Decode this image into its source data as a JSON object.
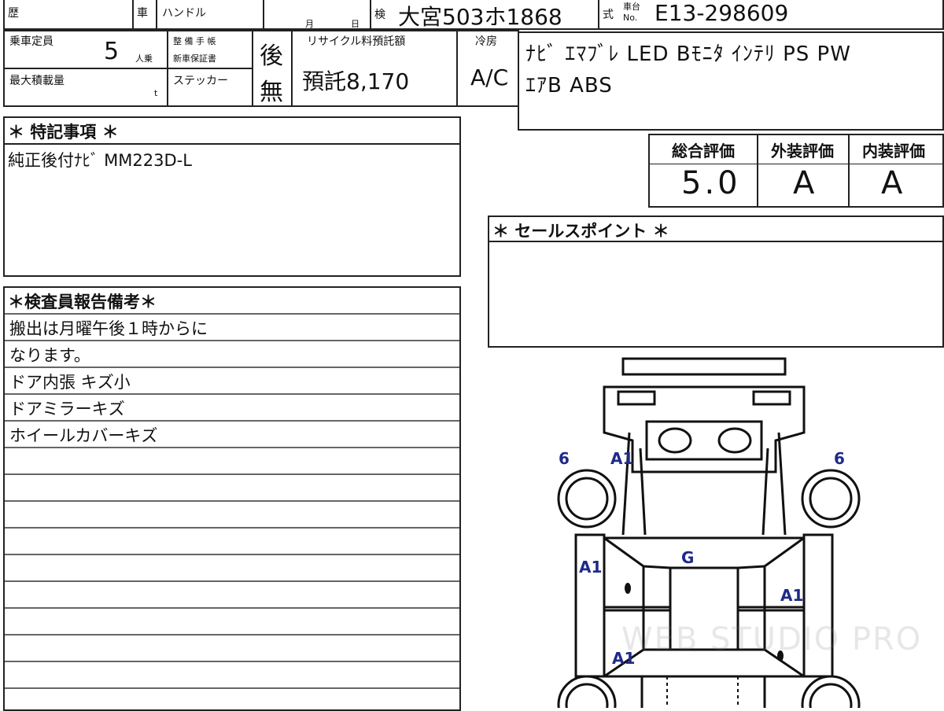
{
  "header": {
    "reki": "歴",
    "sha": "車",
    "handle": "ハンドル",
    "month": "月",
    "day": "日",
    "ken": "検",
    "plate": "大宮503ホ1868",
    "shiki": "式",
    "chassis_label_1": "車台",
    "chassis_label_2": "No.",
    "chassis": "E13-298609"
  },
  "specs": {
    "capacity_label": "乗車定員",
    "capacity_value": "5",
    "capacity_unit": "人乗",
    "max_load_label": "最大積載量",
    "max_load_unit": "t",
    "seibi_label_1": "整 備 手 帳",
    "seibi_label_2": "新車保証書",
    "seibi_value": "後",
    "sticker_label": "ステッカー",
    "sticker_value": "無",
    "recycle_label": "リサイクル料預託額",
    "recycle_value": "預託8,170",
    "cooling_label": "冷房",
    "cooling_value": "A/C"
  },
  "equipment": {
    "line1": "ﾅﾋﾞ ｴﾏﾌﾞﾚ LED Bﾓﾆﾀ ｲﾝﾃﾘ PS PW",
    "line2": "ｴｱB ABS"
  },
  "ratings": {
    "overall_label": "総合評価",
    "exterior_label": "外装評価",
    "interior_label": "内装評価",
    "overall_value": "5.0",
    "exterior_value": "A",
    "interior_value": "A"
  },
  "special_notes": {
    "title": "＊ 特記事項 ＊",
    "text": "純正後付ﾅﾋﾞ MM223D-L"
  },
  "sales_points": {
    "title": "＊ セールスポイント ＊"
  },
  "inspector": {
    "title": "＊検査員報告備考＊",
    "lines": [
      "搬出は月曜午後１時からに",
      "なります。",
      "ドア内張 キズ小",
      "ドアミラーキズ",
      "ホイールカバーキズ"
    ]
  },
  "diagram": {
    "marks": {
      "wheel_front_left": "6",
      "wheel_front_right": "6",
      "fender_front_left": "A1",
      "hood": "G",
      "door_front_left": "A1",
      "door_front_right": "A1",
      "door_rear_left": "A1"
    },
    "mark_color": "#1f2a8a"
  },
  "watermark": "WEB STUDIO PRO"
}
